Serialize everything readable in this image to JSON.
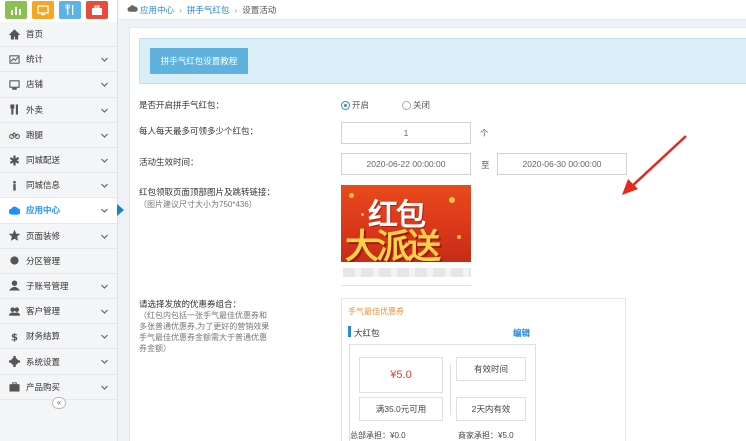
{
  "colors": {
    "accent": "#2b8ad6",
    "active": "#1e90ff",
    "orange": "#f0903a",
    "price": "#e53b2c",
    "arrow": "#e8281c"
  },
  "quick_buttons": [
    {
      "name": "chart-icon",
      "color": "#8cc152"
    },
    {
      "name": "monitor-icon",
      "color": "#f6a623"
    },
    {
      "name": "utensils-icon",
      "color": "#5db2e8"
    },
    {
      "name": "briefcase-icon",
      "color": "#e84c3d"
    }
  ],
  "sidebar": {
    "collapse_label": "«",
    "items": [
      {
        "label": "首页",
        "icon": "home-icon"
      },
      {
        "label": "统计",
        "icon": "stats-icon"
      },
      {
        "label": "店铺",
        "icon": "monitor-icon"
      },
      {
        "label": "外卖",
        "icon": "utensils-icon"
      },
      {
        "label": "跑腿",
        "icon": "bicycle-icon"
      },
      {
        "label": "同城配送",
        "icon": "asterisk-icon"
      },
      {
        "label": "同城信息",
        "icon": "info-icon"
      },
      {
        "label": "应用中心",
        "icon": "cloud-icon"
      },
      {
        "label": "页面装修",
        "icon": "star-icon"
      },
      {
        "label": "分区管理",
        "icon": "gear-small-icon"
      },
      {
        "label": "子账号管理",
        "icon": "user-icon"
      },
      {
        "label": "客户管理",
        "icon": "users-icon"
      },
      {
        "label": "财务结算",
        "icon": "dollar-icon"
      },
      {
        "label": "系统设置",
        "icon": "gear-icon"
      },
      {
        "label": "产品购买",
        "icon": "briefcase-icon"
      }
    ]
  },
  "breadcrumb": {
    "items": [
      "应用中心",
      "拼手气红包"
    ],
    "current": "设置活动"
  },
  "tutorial_button": "拼手气红包设置教程",
  "form": {
    "enable_label": "是否开启拼手气红包：",
    "enable_on": "开启",
    "enable_off": "关闭",
    "max_label": "每人每天最多可领多少个红包：",
    "max_value": "1",
    "max_unit": "个",
    "time_label": "活动生效时间：",
    "start_time": "2020-06-22 00:00:00",
    "time_sep": "至",
    "end_time": "2020-06-30 00:00:00",
    "image_label": "红包领取页面顶部图片及跳转链接：",
    "image_hint": "（图片建议尺寸大小为750*436）",
    "banner_line1": "红包",
    "banner_line2": "大派送",
    "coupon_label": "请选择发放的优惠券组合：",
    "coupon_hint": "（红包内包括一张手气最佳优惠券和多张普通优惠券,为了更好的营销效果手气最佳优惠券金额需大于普通优惠券金额）"
  },
  "coupon": {
    "header": "手气最佳优惠券",
    "name": "大红包",
    "edit": "编辑",
    "price": "¥5.0",
    "condition": "满35.0元可用",
    "valid_label": "有效时间",
    "valid_value": "2天内有效",
    "total": "总部承担：¥0.0",
    "merchant": "商家承担：¥5.0"
  }
}
